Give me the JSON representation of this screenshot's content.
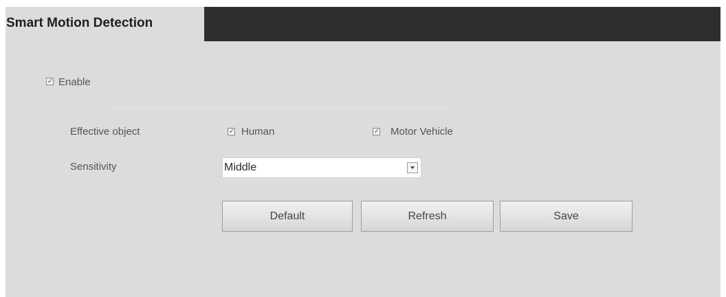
{
  "header": {
    "title": "Smart Motion Detection"
  },
  "enable": {
    "label": "Enable",
    "checked": true
  },
  "effective_object": {
    "label": "Effective object",
    "options": [
      {
        "label": "Human",
        "checked": true
      },
      {
        "label": "Motor Vehicle",
        "checked": true
      }
    ]
  },
  "sensitivity": {
    "label": "Sensitivity",
    "value": "Middle"
  },
  "buttons": {
    "default_label": "Default",
    "refresh_label": "Refresh",
    "save_label": "Save"
  },
  "icons": {
    "checkbox": "checkbox-checked-icon",
    "dropdown": "chevron-down-icon"
  }
}
